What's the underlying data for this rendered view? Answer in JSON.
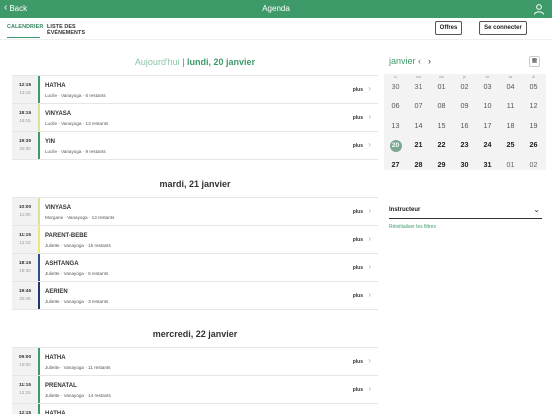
{
  "topbar": {
    "back_label": "Back",
    "title": "Agenda",
    "back_icon": "chevron-left-icon",
    "user_icon": "user-icon"
  },
  "tabs": [
    {
      "label": "CALENDRIER",
      "active": true
    },
    {
      "label": "LISTE DES ÉVÉNEMENTS",
      "active": false
    }
  ],
  "buttons": {
    "offres": "Offres",
    "login": "Se connecter"
  },
  "colors": {
    "brand": "#3f9a6a"
  },
  "days": [
    {
      "today_label": "Aujourd'hui",
      "separator": "|",
      "title": "lundi, 20 janvier",
      "classes": [
        {
          "start": "12:15",
          "end": "13:15",
          "name": "HATHA",
          "meta": "Lucile · Vanayoga · 6 restants",
          "more": "plus",
          "color": "#3f9a6a"
        },
        {
          "start": "18:15",
          "end": "19:15",
          "name": "VINYASA",
          "meta": "Lucile · Vanayoga · 13 restants",
          "more": "plus",
          "color": "#d6e59c"
        },
        {
          "start": "19:30",
          "end": "20:30",
          "name": "YIN",
          "meta": "Lucile · Vanayoga · 9 restants",
          "more": "plus",
          "color": "#3f9a6a"
        }
      ]
    },
    {
      "title": "mardi, 21 janvier",
      "classes": [
        {
          "start": "10:00",
          "end": "11:00",
          "name": "VINYASA",
          "meta": "Morgane · Vanayoga · 13 restants",
          "more": "plus",
          "color": "#d6e59c"
        },
        {
          "start": "11:15",
          "end": "12:15",
          "name": "PARENT-BEBE",
          "meta": "Juliette · Vanayoga · 15 restants",
          "more": "plus",
          "color": "#f0e47a"
        },
        {
          "start": "18:15",
          "end": "19:30",
          "name": "ASHTANGA",
          "meta": "Juliette · Vanayoga · 6 restants",
          "more": "plus",
          "color": "#2f4f7f"
        },
        {
          "start": "19:45",
          "end": "20:45",
          "name": "AERIEN",
          "meta": "Juliette · Vanayoga · 3 restants",
          "more": "plus",
          "color": "#1f3a6a"
        }
      ]
    },
    {
      "title": "mercredi, 22 janvier",
      "classes": [
        {
          "start": "09:00",
          "end": "10:00",
          "name": "HATHA",
          "meta": "Juliette · Vanayoga · 11 restants",
          "more": "plus",
          "color": "#3f9a6a"
        },
        {
          "start": "11:15",
          "end": "12:15",
          "name": "PRENATAL",
          "meta": "Juliette · Vanayoga · 14 restants",
          "more": "plus",
          "color": "#3f9a6a"
        },
        {
          "start": "12:15",
          "end": "",
          "name": "HATHA",
          "meta": "",
          "more": "",
          "color": "#3f9a6a"
        }
      ]
    }
  ],
  "calendar": {
    "month": "janvier",
    "weekdays": [
      "lu",
      "ma",
      "me",
      "je",
      "ve",
      "sa",
      "di"
    ],
    "weeks": [
      [
        "30",
        "31",
        "01",
        "02",
        "03",
        "04",
        "05"
      ],
      [
        "06",
        "07",
        "08",
        "09",
        "10",
        "11",
        "12"
      ],
      [
        "13",
        "14",
        "15",
        "16",
        "17",
        "18",
        "19"
      ],
      [
        "20",
        "21",
        "22",
        "23",
        "24",
        "25",
        "26"
      ],
      [
        "27",
        "28",
        "29",
        "30",
        "31",
        "01",
        "02"
      ]
    ],
    "selected": "20"
  },
  "filters": {
    "instructor_label": "Instructeur",
    "reset_label": "Réinitialiser les filtres"
  }
}
